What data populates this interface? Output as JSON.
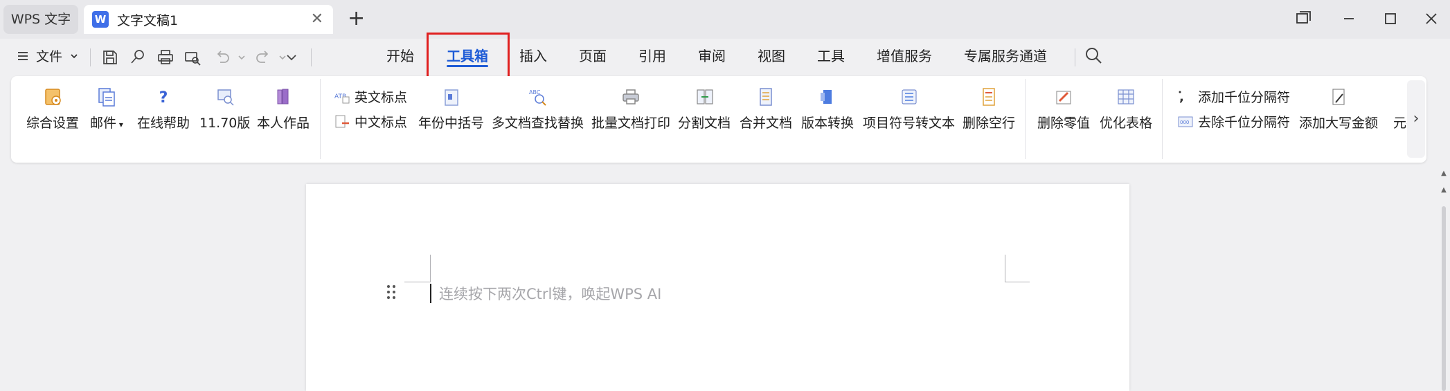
{
  "titlebar": {
    "app_tab": "WPS 文字",
    "doc_tab": {
      "icon_letter": "W",
      "title": "文字文稿1",
      "close": "✕"
    },
    "new_tab": "+"
  },
  "menubar": {
    "file_label": "文件",
    "tabs": [
      "开始",
      "工具箱",
      "插入",
      "页面",
      "引用",
      "审阅",
      "视图",
      "工具",
      "增值服务",
      "专属服务通道"
    ],
    "active_tab": "工具箱"
  },
  "ribbon": {
    "items": [
      {
        "label": "综合设置",
        "icon": "settings-doc-icon"
      },
      {
        "label": "邮件",
        "icon": "mail-merge-icon"
      },
      {
        "label": "在线帮助",
        "icon": "help-icon"
      },
      {
        "label": "11.70版",
        "icon": "version-icon"
      },
      {
        "label": "本人作品",
        "icon": "books-icon"
      },
      {
        "label": "年份中括号",
        "icon": "bracket-doc-icon"
      },
      {
        "label": "多文档查找替换",
        "icon": "find-replace-icon"
      },
      {
        "label": "批量文档打印",
        "icon": "printer-icon"
      },
      {
        "label": "分割文档",
        "icon": "split-doc-icon"
      },
      {
        "label": "合并文档",
        "icon": "merge-doc-icon"
      },
      {
        "label": "版本转换",
        "icon": "convert-icon"
      },
      {
        "label": "项目符号转文本",
        "icon": "bullet-list-icon"
      },
      {
        "label": "删除空行",
        "icon": "delete-blank-lines-icon"
      },
      {
        "label": "删除零值",
        "icon": "delete-zero-icon"
      },
      {
        "label": "优化表格",
        "icon": "table-icon"
      },
      {
        "label": "添加大写金额",
        "icon": "amount-icon"
      },
      {
        "label": "元折",
        "icon": "currency-icon"
      }
    ],
    "small_items": {
      "en_punct": "英文标点",
      "cn_punct": "中文标点",
      "add_thousands": "添加千位分隔符",
      "remove_thousands": "去除千位分隔符"
    },
    "scroll_arrow": "›"
  },
  "document": {
    "placeholder": "连续按下两次Ctrl键，唤起WPS AI"
  },
  "colors": {
    "accent": "#1e5bd6",
    "highlight": "#e02020",
    "background": "#f0f0f2"
  }
}
